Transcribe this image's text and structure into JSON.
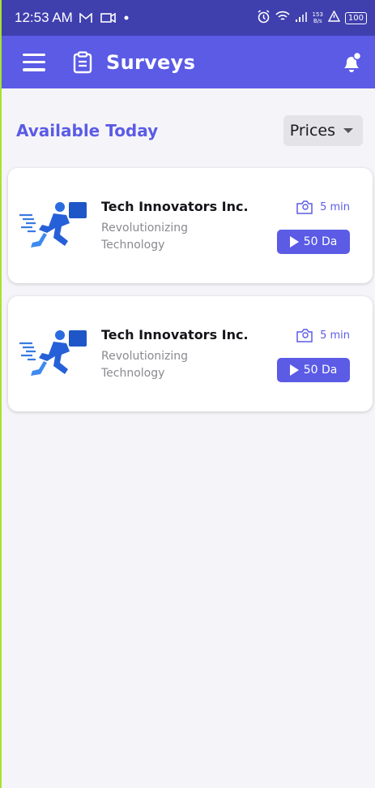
{
  "status_bar": {
    "time": "12:53 AM",
    "net_speed_value": "153",
    "net_speed_unit": "B/s",
    "battery": "100",
    "icons": [
      "gmail-icon",
      "video-camera-icon",
      "notification-dot-icon",
      "alarm-icon",
      "wifi-icon",
      "signal-icon",
      "warning-icon",
      "battery-icon"
    ]
  },
  "app_bar": {
    "title": "Surveys",
    "left_icons": [
      "menu-icon",
      "clipboard-icon"
    ],
    "right_icon": "bell-icon",
    "color": "#5b5be6"
  },
  "section": {
    "title": "Available Today",
    "sort_dropdown": {
      "selected": "Prices"
    }
  },
  "surveys": [
    {
      "company": "Tech Innovators Inc.",
      "description": "Revolutionizing Technology",
      "duration": "5 min",
      "reward_label": "50 Da"
    },
    {
      "company": "Tech Innovators Inc.",
      "description": "Revolutionizing Technology",
      "duration": "5 min",
      "reward_label": "50 Da"
    }
  ],
  "colors": {
    "accent": "#5b5be6",
    "status_bar": "#3f3fae",
    "background": "#f5f5f9"
  }
}
